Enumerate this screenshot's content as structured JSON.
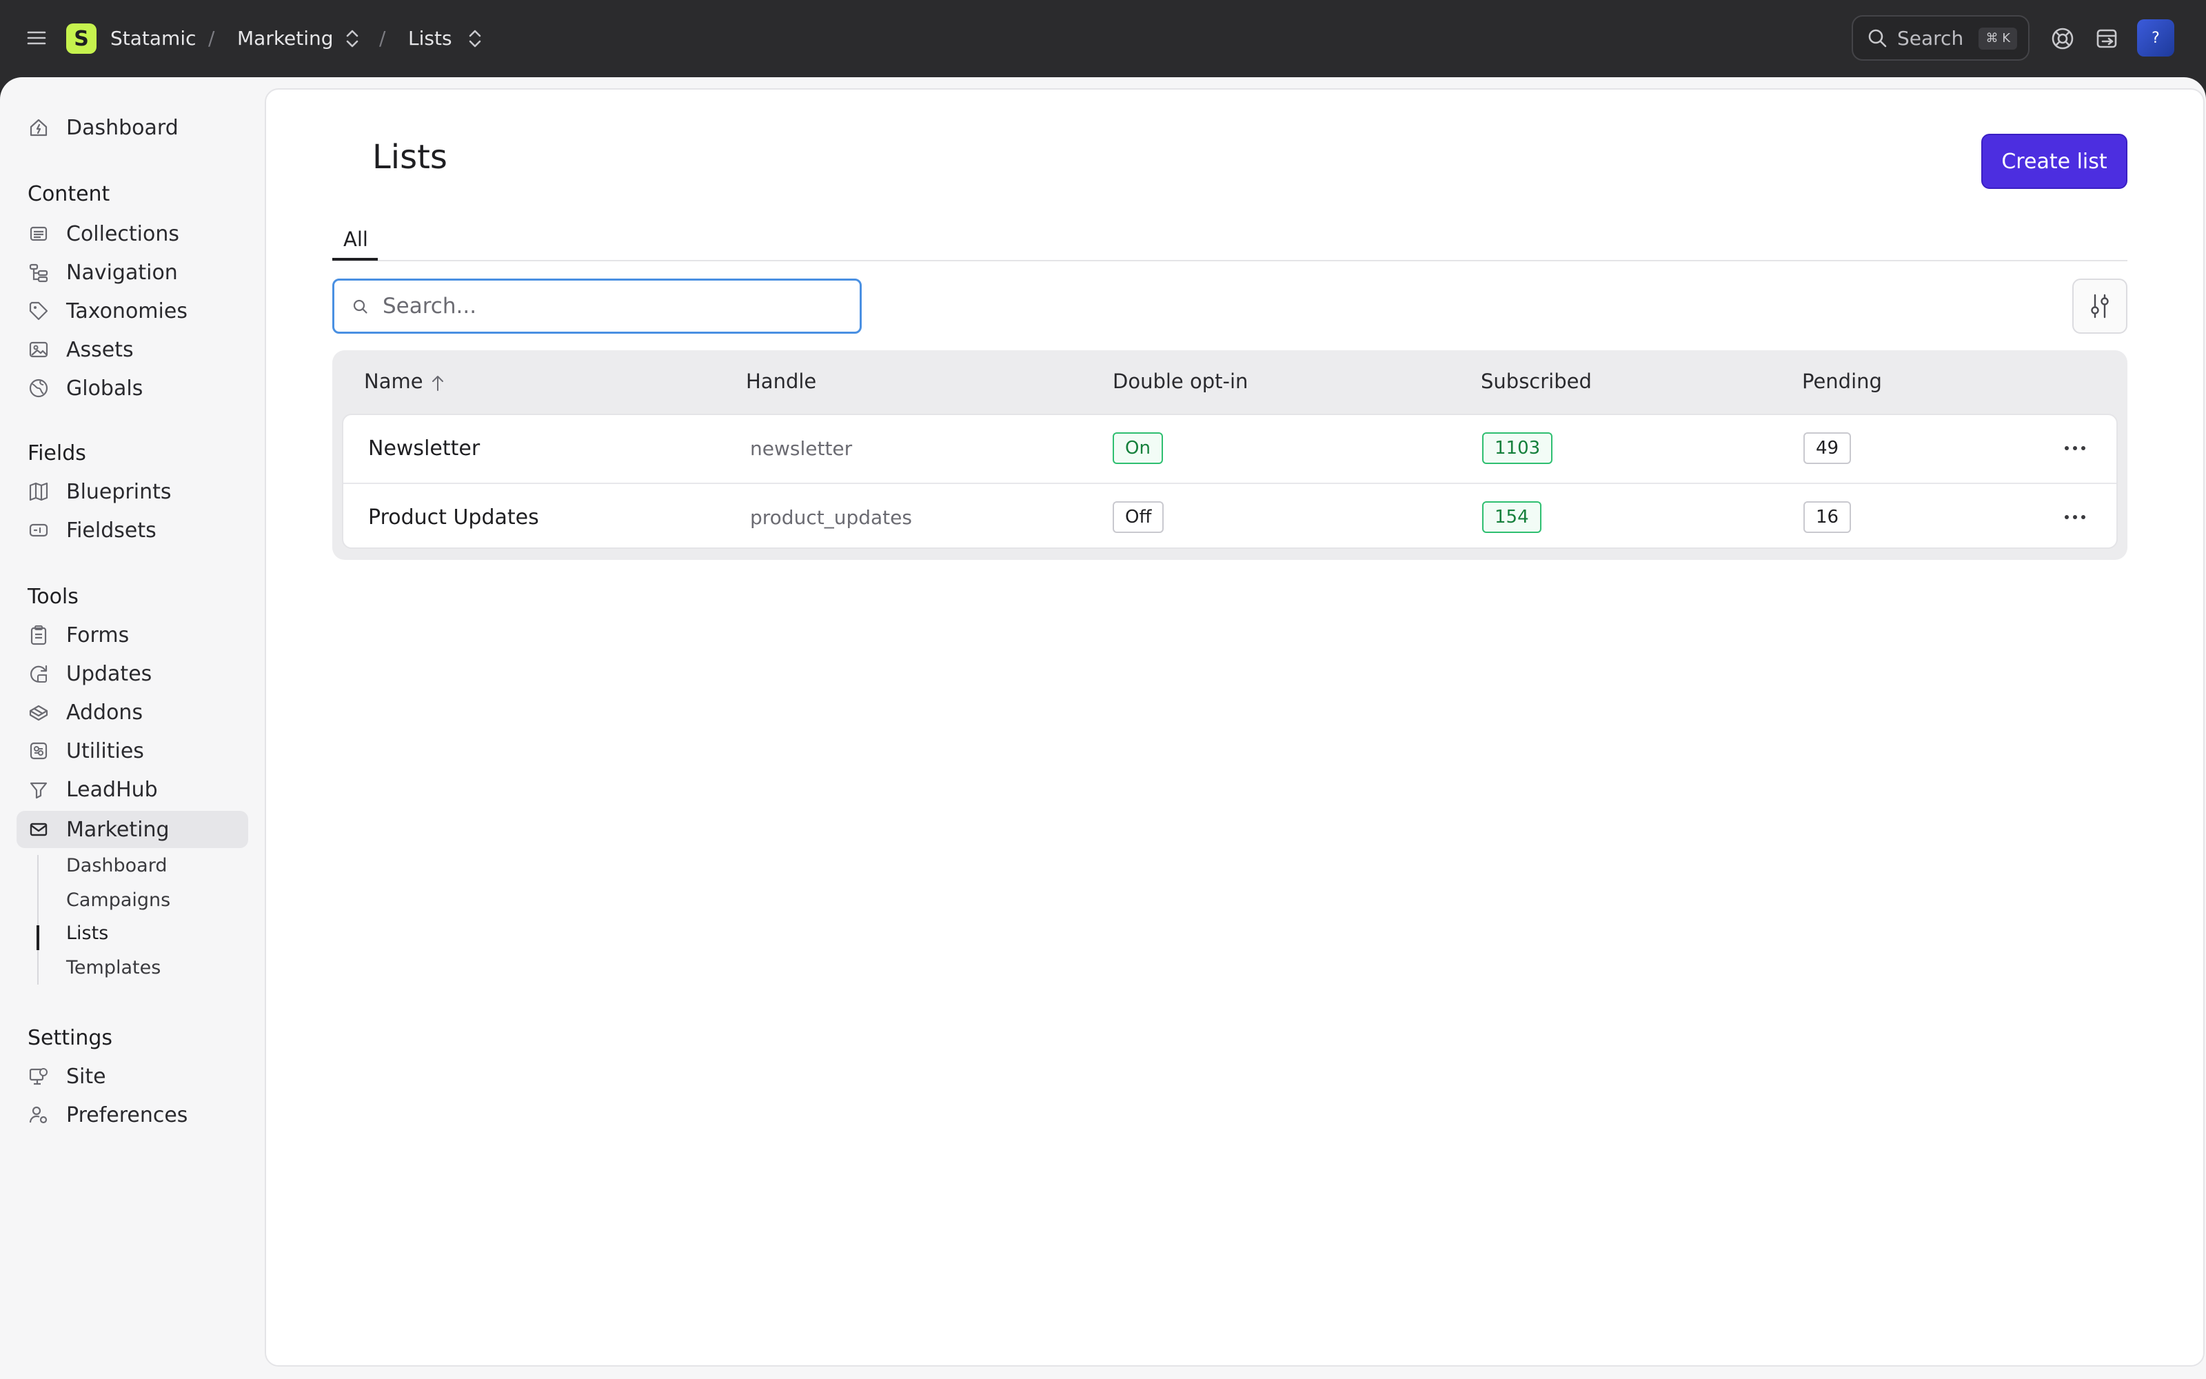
{
  "topbar": {
    "app_name": "Statamic",
    "logo_letter": "S",
    "breadcrumbs": [
      {
        "label": "Marketing"
      },
      {
        "label": "Lists"
      }
    ],
    "separator": "/",
    "search_label": "Search",
    "search_shortcut": "⌘ K",
    "avatar_initial": "?",
    "icons": [
      "menu-icon",
      "help-icon",
      "exit-icon"
    ]
  },
  "sidebar": {
    "dashboard": "Dashboard",
    "sections": [
      {
        "title": "Content",
        "items": [
          "Collections",
          "Navigation",
          "Taxonomies",
          "Assets",
          "Globals"
        ]
      },
      {
        "title": "Fields",
        "items": [
          "Blueprints",
          "Fieldsets"
        ]
      },
      {
        "title": "Tools",
        "items": [
          "Forms",
          "Updates",
          "Addons",
          "Utilities",
          "LeadHub",
          "Marketing"
        ]
      },
      {
        "title": "Settings",
        "items": [
          "Site",
          "Preferences"
        ]
      }
    ],
    "active_item": "Marketing",
    "marketing_sub": [
      "Dashboard",
      "Campaigns",
      "Lists",
      "Templates"
    ],
    "active_sub": "Lists"
  },
  "main": {
    "title": "Lists",
    "create_button": "Create list",
    "tabs": [
      "All"
    ],
    "search_placeholder": "Search...",
    "search_value": "",
    "table": {
      "columns": [
        "Name",
        "Handle",
        "Double opt-in",
        "Subscribed",
        "Pending"
      ],
      "sort_column": "Name",
      "sort_direction": "ascending",
      "rows": [
        {
          "name": "Newsletter",
          "handle": "newsletter",
          "double_opt_in": "On",
          "subscribed": "1103",
          "pending": "49"
        },
        {
          "name": "Product Updates",
          "handle": "product_updates",
          "double_opt_in": "Off",
          "subscribed": "154",
          "pending": "16"
        }
      ]
    }
  },
  "colors": {
    "topbar_bg": "#2b2b2d",
    "logo_accent": "#c6f24e",
    "primary_button": "#4c2ee0",
    "focus_border": "#4a90e2",
    "badge_green": "#2fbf71"
  }
}
